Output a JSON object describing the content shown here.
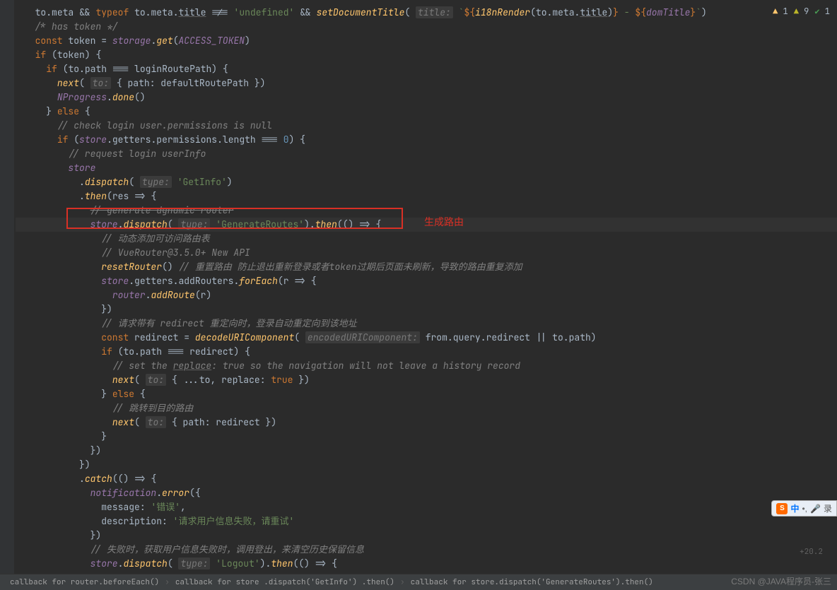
{
  "topBadges": {
    "warn1": "1",
    "warn2": "9",
    "check": "1"
  },
  "code": {
    "l00": "to.meta && typeof to.meta.title !== 'undefined' && setDocumentTitle( title: `${i18nRender(to.meta.title)} - ${domTitle}`)",
    "l01": "/* has token */",
    "l02": "const token = storage.get(ACCESS_TOKEN)",
    "l03": "if (token) {",
    "l04": "if (to.path === loginRoutePath) {",
    "l05": "next( to: { path: defaultRoutePath })",
    "l06": "NProgress.done()",
    "l07": "} else {",
    "l08": "// check login user.permissions is null",
    "l09": "if (store.getters.permissions.length === 0) {",
    "l10": "// request login userInfo",
    "l11": "store",
    "l12": ".dispatch( type: 'GetInfo')",
    "l13": ".then(res => {",
    "l14": "// generate dynamic router",
    "l15": "store.dispatch( type: 'GenerateRoutes').then(() => {",
    "l16": "// 动态添加可访问路由表",
    "l17": "// VueRouter@3.5.0+ New API",
    "l18": "resetRouter() // 重置路由 防止退出重新登录或者token过期后页面未刷新，导致的路由重复添加",
    "l19": "store.getters.addRouters.forEach(r => {",
    "l20": "router.addRoute(r)",
    "l21": "})",
    "l22": "// 请求带有 redirect 重定向时，登录自动重定向到该地址",
    "l23": "const redirect = decodeURIComponent( encodedURIComponent: from.query.redirect || to.path)",
    "l24": "if (to.path === redirect) {",
    "l25": "// set the replace: true so the navigation will not leave a history record",
    "l26": "next( to: { ...to, replace: true })",
    "l27": "} else {",
    "l28": "// 跳转到目的路由",
    "l29": "next( to: { path: redirect })",
    "l30": "}",
    "l31": "})",
    "l32": "})",
    "l33": ".catch(() => {",
    "l34": "notification.error({",
    "l35": "message: '错误',",
    "l36": "description: '请求用户信息失败，请重试'",
    "l37": "})",
    "l38": "// 失败时，获取用户信息失败时，调用登出，来清空历史保留信息",
    "l39": "store.dispatch( type: 'Logout').then(() => {"
  },
  "redLabel": "生成路由",
  "breadcrumbs": [
    "callback for router.beforeEach()",
    "callback for store .dispatch('GetInfo') .then()",
    "callback for store.dispatch('GenerateRoutes').then()"
  ],
  "ime": {
    "icon": "S",
    "lang": "中",
    "rec": "录"
  },
  "watermark": "CSDN @JAVA程序员-张三",
  "watermarkNum": "+20.2"
}
